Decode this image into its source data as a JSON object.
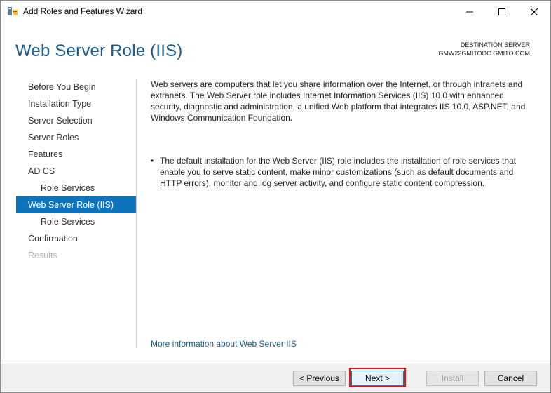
{
  "window": {
    "title": "Add Roles and Features Wizard"
  },
  "header": {
    "page_title": "Web Server Role (IIS)",
    "destination_label": "DESTINATION SERVER",
    "destination_server": "GMW22GMITODC.GMITO.COM"
  },
  "nav": {
    "items": [
      {
        "label": "Before You Begin",
        "state": "normal"
      },
      {
        "label": "Installation Type",
        "state": "normal"
      },
      {
        "label": "Server Selection",
        "state": "normal"
      },
      {
        "label": "Server Roles",
        "state": "normal"
      },
      {
        "label": "Features",
        "state": "normal"
      },
      {
        "label": "AD CS",
        "state": "normal"
      },
      {
        "label": "Role Services",
        "state": "normal"
      },
      {
        "label": "Web Server Role (IIS)",
        "state": "active"
      },
      {
        "label": "Role Services",
        "state": "normal"
      },
      {
        "label": "Confirmation",
        "state": "normal"
      },
      {
        "label": "Results",
        "state": "disabled"
      }
    ]
  },
  "content": {
    "intro": "Web servers are computers that let you share information over the Internet, or through intranets and extranets. The Web Server role includes Internet Information Services (IIS) 10.0 with enhanced security, diagnostic and administration, a unified Web platform that integrates IIS 10.0, ASP.NET, and Windows Communication Foundation.",
    "bullet_symbol": "•",
    "bullet": "The default installation for the Web Server (IIS) role includes the installation of role services that enable you to serve static content, make minor customizations (such as default documents and HTTP errors), monitor and log server activity, and configure static content compression.",
    "more_link": "More information about Web Server IIS"
  },
  "footer": {
    "previous": "< Previous",
    "next": "Next >",
    "install": "Install",
    "cancel": "Cancel"
  },
  "colors": {
    "accent": "#0d73bc",
    "title_blue": "#1a5d8e",
    "highlight": "#e2141d"
  },
  "icons": {
    "app": "server-manager-icon",
    "minimize": "minimize-icon",
    "maximize": "maximize-icon",
    "close": "close-icon"
  }
}
